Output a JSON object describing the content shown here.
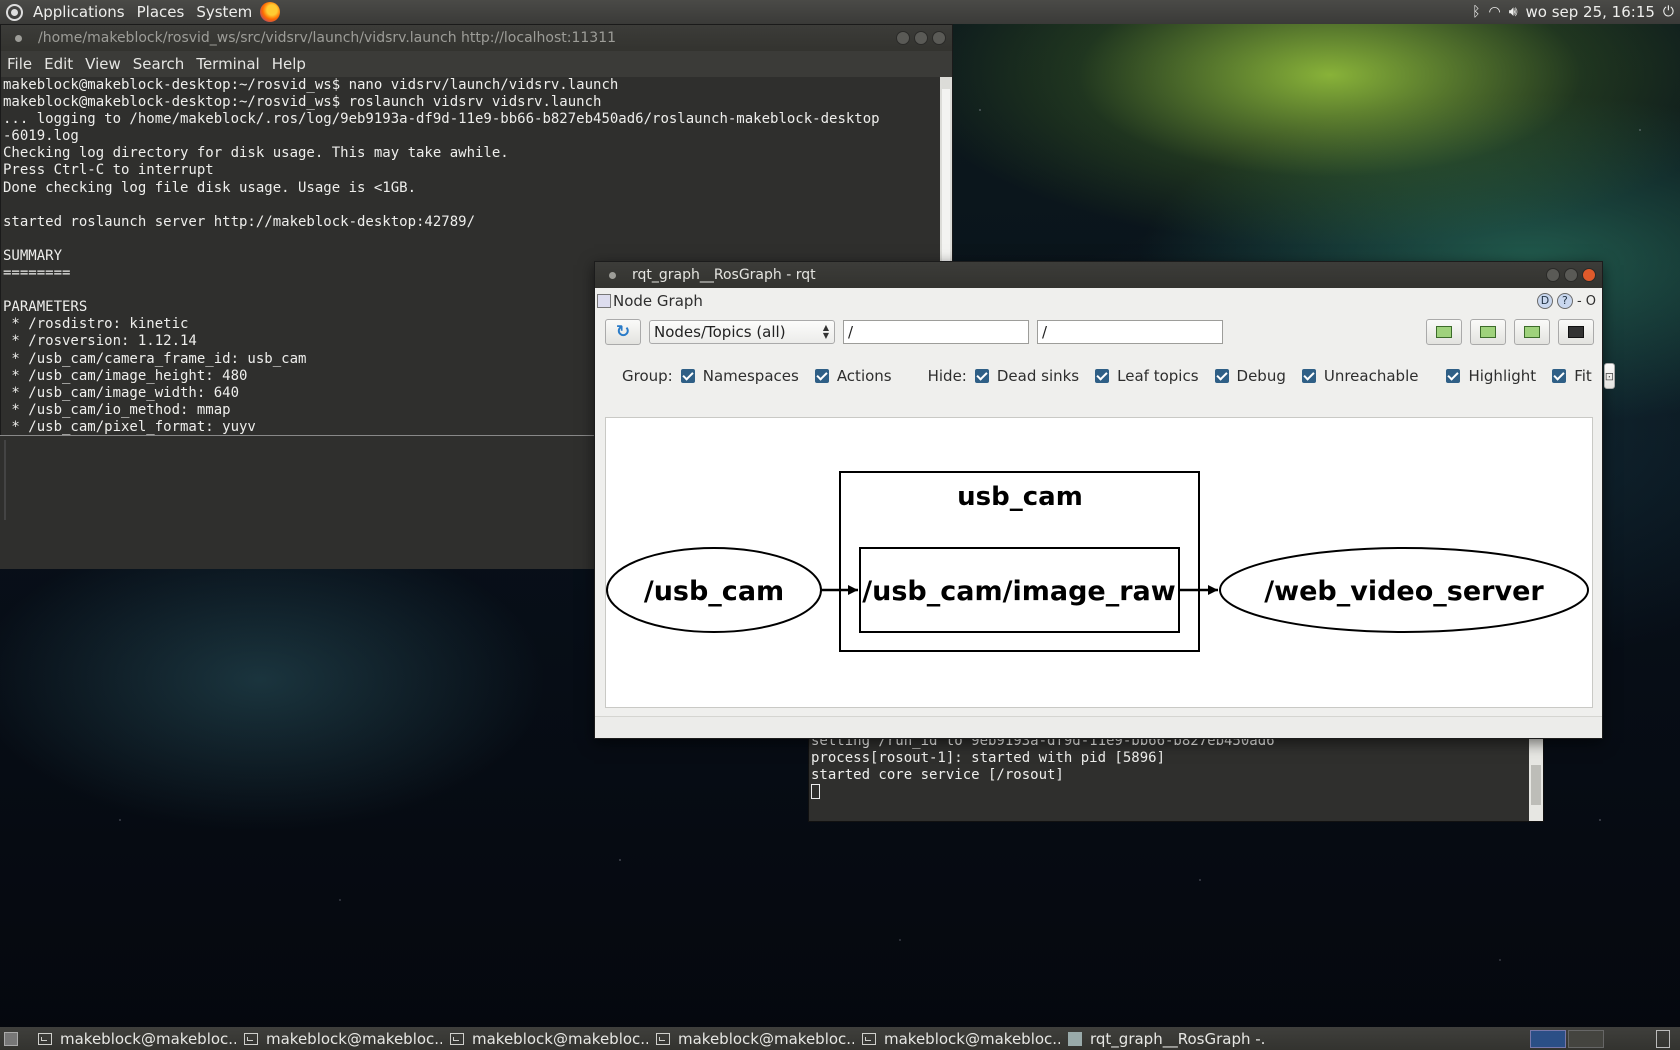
{
  "top_panel": {
    "menus": [
      "Applications",
      "Places",
      "System"
    ],
    "clock": "wo sep 25, 16:15"
  },
  "terminal1": {
    "title": "/home/makeblock/rosvid_ws/src/vidsrv/launch/vidsrv.launch http://localhost:11311",
    "menus": [
      "File",
      "Edit",
      "View",
      "Search",
      "Terminal",
      "Help"
    ],
    "output": "makeblock@makeblock-desktop:~/rosvid_ws$ nano vidsrv/launch/vidsrv.launch\nmakeblock@makeblock-desktop:~/rosvid_ws$ roslaunch vidsrv vidsrv.launch\n... logging to /home/makeblock/.ros/log/9eb9193a-df9d-11e9-bb66-b827eb450ad6/roslaunch-makeblock-desktop\n-6019.log\nChecking log directory for disk usage. This may take awhile.\nPress Ctrl-C to interrupt\nDone checking log file disk usage. Usage is <1GB.\n\nstarted roslaunch server http://makeblock-desktop:42789/\n\nSUMMARY\n========\n\nPARAMETERS\n * /rosdistro: kinetic\n * /rosversion: 1.12.14\n * /usb_cam/camera_frame_id: usb_cam\n * /usb_cam/image_height: 480\n * /usb_cam/image_width: 640\n * /usb_cam/io_method: mmap\n * /usb_cam/pixel_format: yuyv"
  },
  "terminal2": {
    "output": "setting /run_id to 9eb9193a-df9d-11e9-bb66-b827eb450ad6\nprocess[rosout-1]: started with pid [5896]\nstarted core service [/rosout]"
  },
  "rqt": {
    "title": "rqt_graph__RosGraph - rqt",
    "plugin_title": "Node Graph",
    "help_label": "D",
    "help_q": "?",
    "close_label": "- O",
    "mode_select": "Nodes/Topics (all)",
    "filter_ns": "/",
    "filter_topic": "/",
    "group_label": "Group:",
    "group_options": [
      "Namespaces",
      "Actions"
    ],
    "hide_label": "Hide:",
    "hide_options": [
      "Dead sinks",
      "Leaf topics",
      "Debug",
      "Unreachable"
    ],
    "view_options": [
      "Highlight",
      "Fit"
    ],
    "graph": {
      "namespace_box": "usb_cam",
      "nodes": [
        "/usb_cam",
        "/web_video_server"
      ],
      "topic": "/usb_cam/image_raw"
    }
  },
  "taskbar": {
    "tasks": [
      "makeblock@makebloc...",
      "makeblock@makebloc...",
      "makeblock@makebloc...",
      "makeblock@makebloc...",
      "makeblock@makebloc...",
      "rqt_graph__RosGraph -..."
    ]
  }
}
